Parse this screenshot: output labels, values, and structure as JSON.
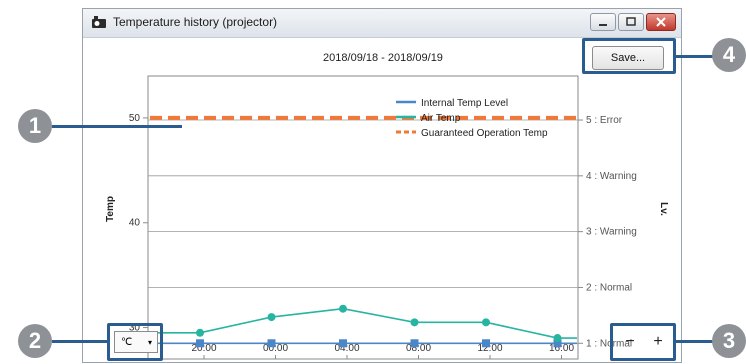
{
  "window": {
    "title": "Temperature history (projector)"
  },
  "chart_header": {
    "date_range": "2018/09/18 - 2018/09/19"
  },
  "toolbar": {
    "save_label": "Save..."
  },
  "unit_select": {
    "value": "℃",
    "arrow": "▾"
  },
  "zoom": {
    "minus": "−",
    "plus": "+"
  },
  "callouts": {
    "n1": "1",
    "n2": "2",
    "n3": "3",
    "n4": "4"
  },
  "colors": {
    "internal": "#4a86c8",
    "air": "#27b5a2",
    "guaranteed": "#f07838",
    "callout": "#2a5c8f",
    "badge": "#8e9296"
  },
  "icons": {
    "app": "projector-icon",
    "minimize": "minimize-icon",
    "maximize": "maximize-icon",
    "close": "close-icon"
  },
  "chart_data": {
    "type": "line",
    "ylabel": "Temp",
    "y2label": "Lv.",
    "xticks": [
      "20:00",
      "00:00",
      "04:00",
      "08:00",
      "12:00",
      "16:00"
    ],
    "yticks": [
      30,
      40,
      50
    ],
    "y2ticks": [
      "1 : Normal",
      "2 : Normal",
      "3 : Warning",
      "4 : Warning",
      "5 : Error"
    ],
    "ylim": [
      27,
      54
    ],
    "grid": true,
    "legend": "top-right",
    "series": [
      {
        "name": "Internal Temp Level",
        "style": "line-square",
        "points": [
          [
            20,
            1
          ],
          [
            0,
            1
          ],
          [
            4,
            1
          ],
          [
            8,
            1
          ],
          [
            12,
            1
          ],
          [
            16,
            1
          ]
        ]
      },
      {
        "name": "Air Temp",
        "style": "line-circle",
        "points": [
          [
            20,
            29.5
          ],
          [
            0,
            31
          ],
          [
            4,
            31.8
          ],
          [
            8,
            30.5
          ],
          [
            12,
            30.5
          ],
          [
            16,
            29
          ]
        ]
      },
      {
        "name": "Guaranteed Operation Temp",
        "style": "dashed",
        "points": [
          [
            20,
            50
          ],
          [
            16,
            50
          ]
        ]
      }
    ]
  }
}
